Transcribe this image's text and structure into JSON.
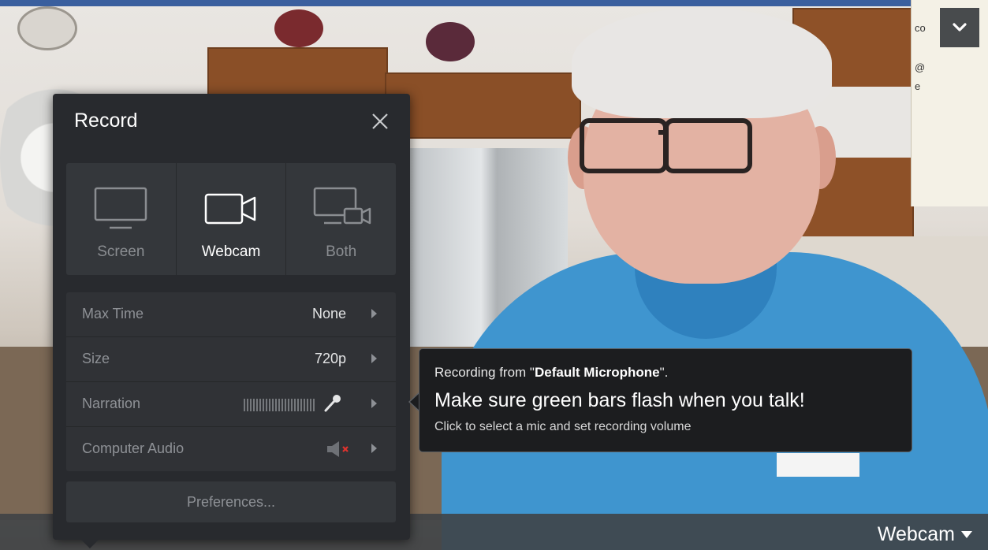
{
  "panel": {
    "title": "Record",
    "close_icon": "close-icon"
  },
  "modes": [
    {
      "label": "Screen",
      "icon": "monitor-icon",
      "selected": false
    },
    {
      "label": "Webcam",
      "icon": "webcam-icon",
      "selected": true
    },
    {
      "label": "Both",
      "icon": "screen-and-webcam-icon",
      "selected": false
    }
  ],
  "settings": {
    "max_time": {
      "label": "Max Time",
      "value": "None"
    },
    "size": {
      "label": "Size",
      "value": "720p"
    },
    "narration": {
      "label": "Narration",
      "icon": "microphone-icon"
    },
    "computer_audio": {
      "label": "Computer Audio",
      "icon": "speaker-muted-icon"
    }
  },
  "preferences": {
    "label": "Preferences..."
  },
  "tooltip": {
    "prefix": "Recording from \"",
    "mic_name": "Default Microphone",
    "suffix": "\".",
    "headline": "Make sure green bars flash when you talk!",
    "hint": "Click to select a mic and set recording volume"
  },
  "source_selector": {
    "label": "Webcam",
    "icon": "caret-down-icon"
  },
  "collapse": {
    "icon": "chevron-down-icon"
  },
  "background_doc": {
    "lines": [
      "co",
      "@",
      "e"
    ]
  },
  "colors": {
    "panel_bg": "#282a2e",
    "row_bg": "#303236",
    "tooltip_bg": "#1c1d1f",
    "muted_x": "#e0322d"
  }
}
